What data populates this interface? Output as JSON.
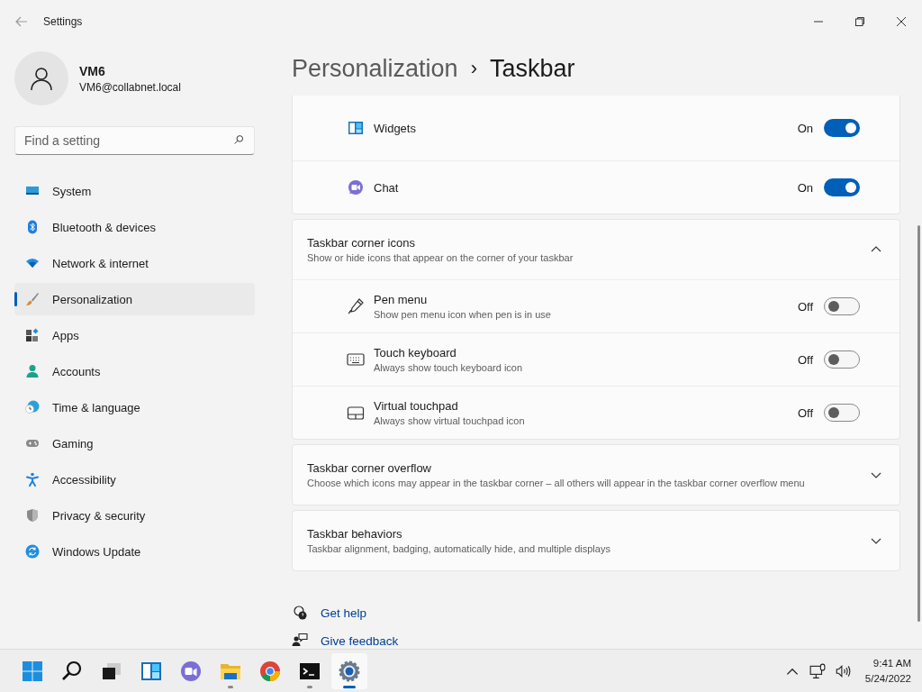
{
  "window": {
    "title": "Settings"
  },
  "user": {
    "name": "VM6",
    "email": "VM6@collabnet.local"
  },
  "search": {
    "placeholder": "Find a setting"
  },
  "nav": [
    {
      "label": "System",
      "selected": false
    },
    {
      "label": "Bluetooth & devices",
      "selected": false
    },
    {
      "label": "Network & internet",
      "selected": false
    },
    {
      "label": "Personalization",
      "selected": true
    },
    {
      "label": "Apps",
      "selected": false
    },
    {
      "label": "Accounts",
      "selected": false
    },
    {
      "label": "Time & language",
      "selected": false
    },
    {
      "label": "Gaming",
      "selected": false
    },
    {
      "label": "Accessibility",
      "selected": false
    },
    {
      "label": "Privacy & security",
      "selected": false
    },
    {
      "label": "Windows Update",
      "selected": false
    }
  ],
  "breadcrumb": {
    "parent": "Personalization",
    "separator": "›",
    "current": "Taskbar"
  },
  "sections": [
    {
      "kind": "list",
      "rows": [
        {
          "title": "Widgets",
          "state_text": "On",
          "on": true
        },
        {
          "title": "Chat",
          "state_text": "On",
          "on": true
        }
      ]
    },
    {
      "kind": "expander",
      "title": "Taskbar corner icons",
      "description": "Show or hide icons that appear on the corner of your taskbar",
      "expanded": true,
      "rows": [
        {
          "title": "Pen menu",
          "description": "Show pen menu icon when pen is in use",
          "state_text": "Off",
          "on": false
        },
        {
          "title": "Touch keyboard",
          "description": "Always show touch keyboard icon",
          "state_text": "Off",
          "on": false
        },
        {
          "title": "Virtual touchpad",
          "description": "Always show virtual touchpad icon",
          "state_text": "Off",
          "on": false
        }
      ]
    },
    {
      "kind": "expander",
      "title": "Taskbar corner overflow",
      "description": "Choose which icons may appear in the taskbar corner – all others will appear in the taskbar corner overflow menu",
      "expanded": false
    },
    {
      "kind": "expander",
      "title": "Taskbar behaviors",
      "description": "Taskbar alignment, badging, automatically hide, and multiple displays",
      "expanded": false
    }
  ],
  "links": [
    "Get help",
    "Give feedback"
  ],
  "taskbar": {
    "apps": [
      {
        "running": false,
        "active": false
      },
      {
        "running": false,
        "active": false
      },
      {
        "running": false,
        "active": false
      },
      {
        "running": false,
        "active": false
      },
      {
        "running": false,
        "active": false
      },
      {
        "running": true,
        "active": false
      },
      {
        "running": false,
        "active": false
      },
      {
        "running": true,
        "active": false
      },
      {
        "running": true,
        "active": true
      }
    ],
    "time": "9:41 AM",
    "date": "5/24/2022"
  }
}
